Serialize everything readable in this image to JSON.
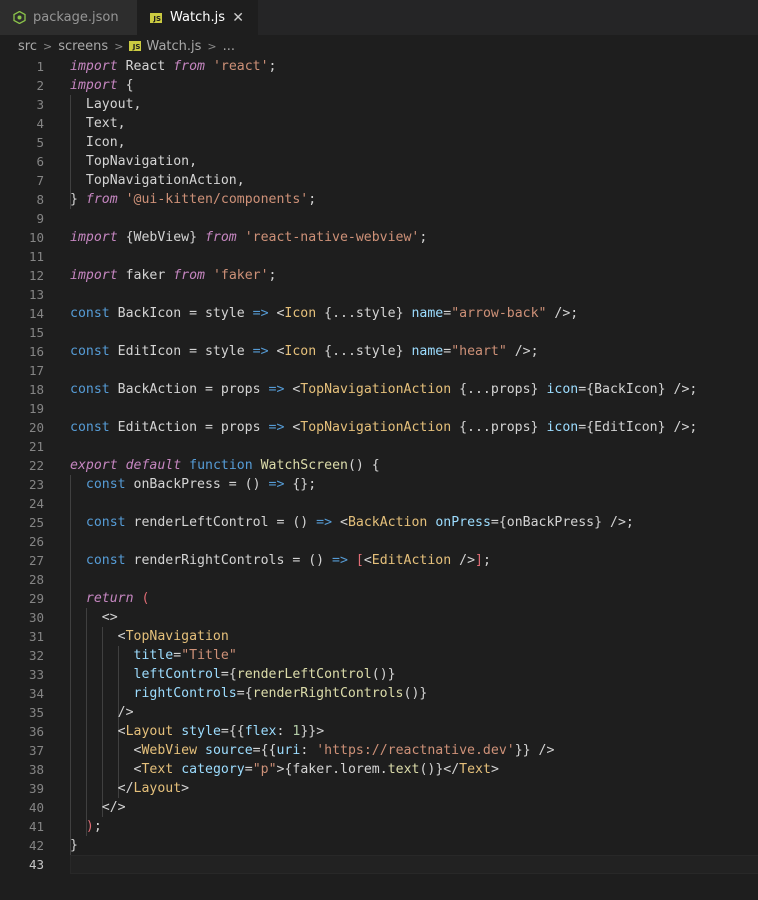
{
  "tabs": [
    {
      "label": "package.json",
      "icon": "npm-json-icon",
      "active": false
    },
    {
      "label": "Watch.js",
      "icon": "js-file-icon",
      "active": true
    }
  ],
  "breadcrumb": {
    "parts": [
      "src",
      "screens",
      "Watch.js",
      "..."
    ],
    "icon_text": "JS"
  },
  "close_glyph": "✕",
  "current_line": 43,
  "lines": [
    [
      [
        "kw",
        "import"
      ],
      [
        "var",
        " React "
      ],
      [
        "kw",
        "from"
      ],
      [
        "var",
        " "
      ],
      [
        "str",
        "'react'"
      ],
      [
        "pun",
        ";"
      ]
    ],
    [
      [
        "kw",
        "import"
      ],
      [
        "var",
        " {"
      ]
    ],
    [
      [
        "var",
        "  Layout,"
      ]
    ],
    [
      [
        "var",
        "  Text,"
      ]
    ],
    [
      [
        "var",
        "  Icon,"
      ]
    ],
    [
      [
        "var",
        "  TopNavigation,"
      ]
    ],
    [
      [
        "var",
        "  TopNavigationAction,"
      ]
    ],
    [
      [
        "var",
        "} "
      ],
      [
        "kw",
        "from"
      ],
      [
        "var",
        " "
      ],
      [
        "str",
        "'@ui-kitten/components'"
      ],
      [
        "pun",
        ";"
      ]
    ],
    [],
    [
      [
        "kw",
        "import"
      ],
      [
        "var",
        " {WebView} "
      ],
      [
        "kw",
        "from"
      ],
      [
        "var",
        " "
      ],
      [
        "str",
        "'react-native-webview'"
      ],
      [
        "pun",
        ";"
      ]
    ],
    [],
    [
      [
        "kw",
        "import"
      ],
      [
        "var",
        " faker "
      ],
      [
        "kw",
        "from"
      ],
      [
        "var",
        " "
      ],
      [
        "str",
        "'faker'"
      ],
      [
        "pun",
        ";"
      ]
    ],
    [],
    [
      [
        "kc",
        "const"
      ],
      [
        "var",
        " BackIcon = style "
      ],
      [
        "kc",
        "=>"
      ],
      [
        "var",
        " "
      ],
      [
        "pun",
        "<"
      ],
      [
        "tag",
        "Icon"
      ],
      [
        "var",
        " {...style} "
      ],
      [
        "attr",
        "name"
      ],
      [
        "pun",
        "="
      ],
      [
        "str",
        "\"arrow-back\""
      ],
      [
        "pun",
        " />;"
      ]
    ],
    [],
    [
      [
        "kc",
        "const"
      ],
      [
        "var",
        " EditIcon = style "
      ],
      [
        "kc",
        "=>"
      ],
      [
        "var",
        " "
      ],
      [
        "pun",
        "<"
      ],
      [
        "tag",
        "Icon"
      ],
      [
        "var",
        " {...style} "
      ],
      [
        "attr",
        "name"
      ],
      [
        "pun",
        "="
      ],
      [
        "str",
        "\"heart\""
      ],
      [
        "pun",
        " />;"
      ]
    ],
    [],
    [
      [
        "kc",
        "const"
      ],
      [
        "var",
        " BackAction = props "
      ],
      [
        "kc",
        "=>"
      ],
      [
        "var",
        " "
      ],
      [
        "pun",
        "<"
      ],
      [
        "tag",
        "TopNavigationAction"
      ],
      [
        "var",
        " {...props} "
      ],
      [
        "attr",
        "icon"
      ],
      [
        "pun",
        "={"
      ],
      [
        "var",
        "BackIcon"
      ],
      [
        "pun",
        "} />;"
      ]
    ],
    [],
    [
      [
        "kc",
        "const"
      ],
      [
        "var",
        " EditAction = props "
      ],
      [
        "kc",
        "=>"
      ],
      [
        "var",
        " "
      ],
      [
        "pun",
        "<"
      ],
      [
        "tag",
        "TopNavigationAction"
      ],
      [
        "var",
        " {...props} "
      ],
      [
        "attr",
        "icon"
      ],
      [
        "pun",
        "={"
      ],
      [
        "var",
        "EditIcon"
      ],
      [
        "pun",
        "} />;"
      ]
    ],
    [],
    [
      [
        "kw",
        "export"
      ],
      [
        "var",
        " "
      ],
      [
        "kw",
        "default"
      ],
      [
        "var",
        " "
      ],
      [
        "kc",
        "function"
      ],
      [
        "var",
        " "
      ],
      [
        "fn",
        "WatchScreen"
      ],
      [
        "var",
        "() {"
      ]
    ],
    [
      [
        "var",
        "  "
      ],
      [
        "kc",
        "const"
      ],
      [
        "var",
        " onBackPress = () "
      ],
      [
        "kc",
        "=>"
      ],
      [
        "var",
        " {};"
      ]
    ],
    [],
    [
      [
        "var",
        "  "
      ],
      [
        "kc",
        "const"
      ],
      [
        "var",
        " renderLeftControl = () "
      ],
      [
        "kc",
        "=>"
      ],
      [
        "var",
        " "
      ],
      [
        "pun",
        "<"
      ],
      [
        "tag",
        "BackAction"
      ],
      [
        "var",
        " "
      ],
      [
        "attr",
        "onPress"
      ],
      [
        "pun",
        "={"
      ],
      [
        "var",
        "onBackPress"
      ],
      [
        "pun",
        "} />;"
      ]
    ],
    [],
    [
      [
        "var",
        "  "
      ],
      [
        "kc",
        "const"
      ],
      [
        "var",
        " renderRightControls = () "
      ],
      [
        "kc",
        "=>"
      ],
      [
        "var",
        " "
      ],
      [
        "red",
        "["
      ],
      [
        "pun",
        "<"
      ],
      [
        "tag",
        "EditAction"
      ],
      [
        "pun",
        " />"
      ],
      [
        "red",
        "]"
      ],
      [
        "pun",
        ";"
      ]
    ],
    [],
    [
      [
        "var",
        "  "
      ],
      [
        "kw",
        "return"
      ],
      [
        "var",
        " "
      ],
      [
        "red",
        "("
      ]
    ],
    [
      [
        "var",
        "    "
      ],
      [
        "pun",
        "<>"
      ]
    ],
    [
      [
        "var",
        "      "
      ],
      [
        "pun",
        "<"
      ],
      [
        "tag",
        "TopNavigation"
      ]
    ],
    [
      [
        "var",
        "        "
      ],
      [
        "attr",
        "title"
      ],
      [
        "pun",
        "="
      ],
      [
        "str",
        "\"Title\""
      ]
    ],
    [
      [
        "var",
        "        "
      ],
      [
        "attr",
        "leftControl"
      ],
      [
        "pun",
        "={"
      ],
      [
        "fn",
        "renderLeftControl"
      ],
      [
        "var",
        "()"
      ],
      [
        "pun",
        "}"
      ]
    ],
    [
      [
        "var",
        "        "
      ],
      [
        "attr",
        "rightControls"
      ],
      [
        "pun",
        "={"
      ],
      [
        "fn",
        "renderRightControls"
      ],
      [
        "var",
        "()"
      ],
      [
        "pun",
        "}"
      ]
    ],
    [
      [
        "var",
        "      "
      ],
      [
        "pun",
        "/>"
      ]
    ],
    [
      [
        "var",
        "      "
      ],
      [
        "pun",
        "<"
      ],
      [
        "tag",
        "Layout"
      ],
      [
        "var",
        " "
      ],
      [
        "attr",
        "style"
      ],
      [
        "pun",
        "={{"
      ],
      [
        "attr",
        "flex"
      ],
      [
        "pun",
        ": "
      ],
      [
        "num",
        "1"
      ],
      [
        "pun",
        "}}>"
      ]
    ],
    [
      [
        "var",
        "        "
      ],
      [
        "pun",
        "<"
      ],
      [
        "tag",
        "WebView"
      ],
      [
        "var",
        " "
      ],
      [
        "attr",
        "source"
      ],
      [
        "pun",
        "={{"
      ],
      [
        "attr",
        "uri"
      ],
      [
        "pun",
        ": "
      ],
      [
        "str",
        "'https://reactnative.dev'"
      ],
      [
        "pun",
        "}} />"
      ]
    ],
    [
      [
        "var",
        "        "
      ],
      [
        "pun",
        "<"
      ],
      [
        "tag",
        "Text"
      ],
      [
        "var",
        " "
      ],
      [
        "attr",
        "category"
      ],
      [
        "pun",
        "="
      ],
      [
        "str",
        "\"p\""
      ],
      [
        "pun",
        ">{"
      ],
      [
        "var",
        "faker.lorem."
      ],
      [
        "fn",
        "text"
      ],
      [
        "var",
        "()"
      ],
      [
        "pun",
        "}</"
      ],
      [
        "tag",
        "Text"
      ],
      [
        "pun",
        ">"
      ]
    ],
    [
      [
        "var",
        "      "
      ],
      [
        "pun",
        "</"
      ],
      [
        "tag",
        "Layout"
      ],
      [
        "pun",
        ">"
      ]
    ],
    [
      [
        "var",
        "    "
      ],
      [
        "pun",
        "</>"
      ]
    ],
    [
      [
        "var",
        "  "
      ],
      [
        "red",
        ")"
      ],
      [
        "pun",
        ";"
      ]
    ],
    [
      [
        "pun",
        "}"
      ]
    ],
    []
  ]
}
